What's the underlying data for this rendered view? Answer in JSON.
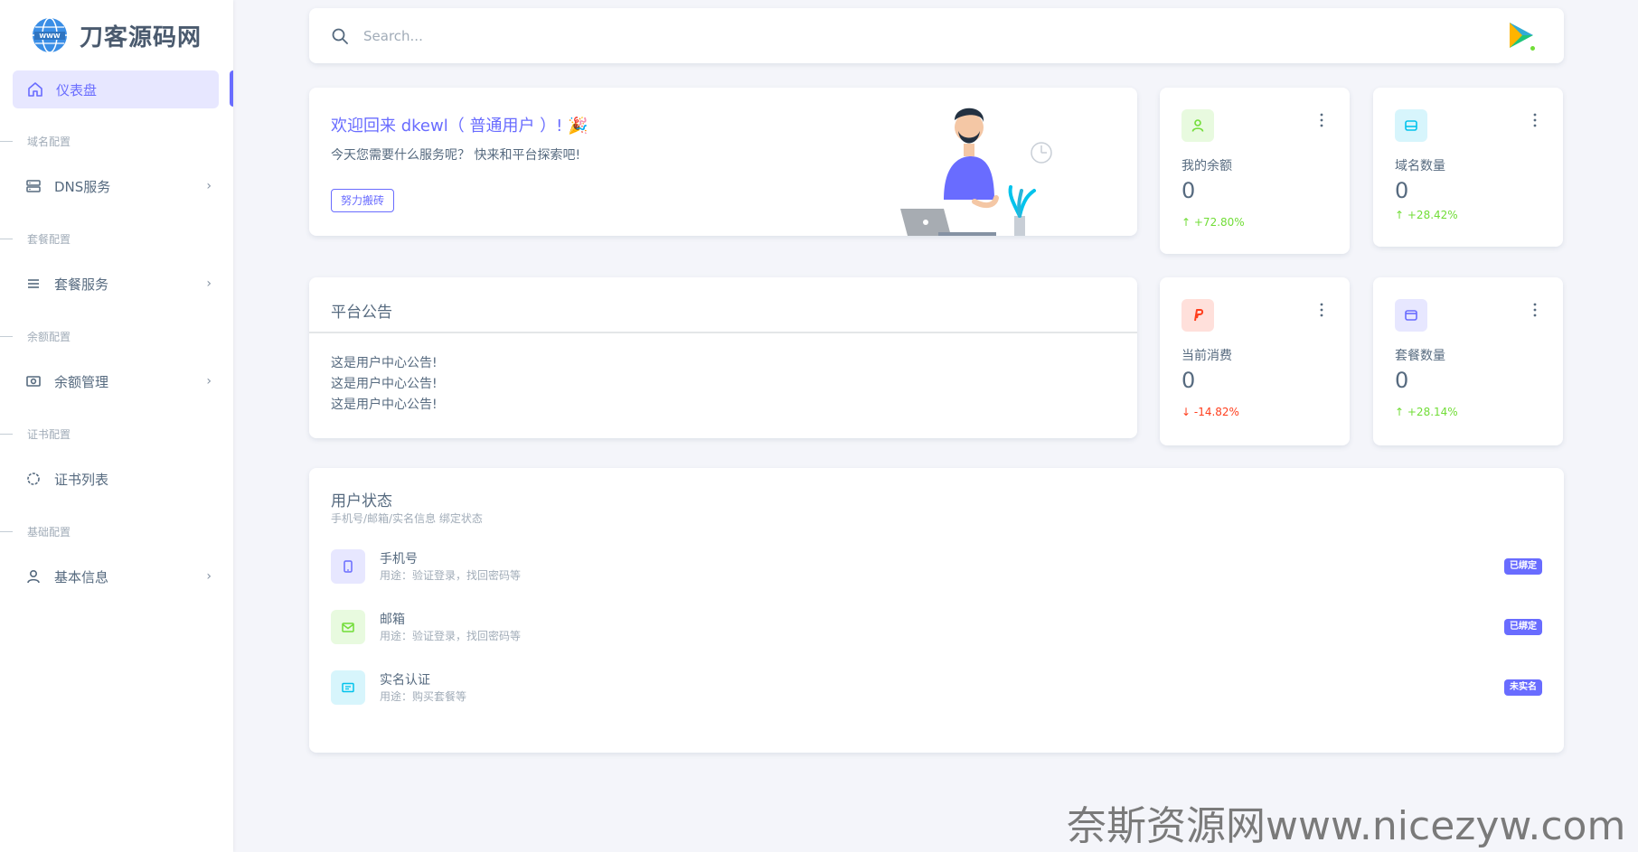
{
  "brand": {
    "name": "刀客源码网"
  },
  "sidebar": {
    "active": {
      "label": "仪表盘"
    },
    "sections": [
      {
        "head": "域名配置",
        "item": "DNS服务"
      },
      {
        "head": "套餐配置",
        "item": "套餐服务"
      },
      {
        "head": "余额配置",
        "item": "余额管理"
      },
      {
        "head": "证书配置",
        "item": "证书列表"
      },
      {
        "head": "基础配置",
        "item": "基本信息"
      }
    ]
  },
  "search": {
    "placeholder": "Search..."
  },
  "welcome": {
    "title": "欢迎回来 dkewl（ 普通用户 ）! 🎉",
    "subtitle": "今天您需要什么服务呢？ 快来和平台探索吧!",
    "button": "努力搬砖"
  },
  "notice": {
    "title": "平台公告",
    "lines": [
      "这是用户中心公告!",
      "这是用户中心公告!",
      "这是用户中心公告!"
    ]
  },
  "stats": [
    {
      "label": "我的余额",
      "value": "0",
      "change": "+72.80%",
      "direction": "up",
      "icon": "user-icon",
      "color": "#71dd37",
      "bg": "#e8fadf"
    },
    {
      "label": "域名数量",
      "value": "0",
      "change": "+28.42%",
      "direction": "up",
      "icon": "drive-icon",
      "color": "#03c3ec",
      "bg": "#d7f5fc"
    },
    {
      "label": "当前消费",
      "value": "0",
      "change": "-14.82%",
      "direction": "down",
      "icon": "paypal-icon",
      "color": "#ff3e1d",
      "bg": "#ffe0db"
    },
    {
      "label": "套餐数量",
      "value": "0",
      "change": "+28.14%",
      "direction": "up",
      "icon": "wallet-icon",
      "color": "#696cff",
      "bg": "#e7e7ff"
    }
  ],
  "user_status": {
    "title": "用户状态",
    "subtitle": "手机号/邮箱/实名信息 绑定状态",
    "rows": [
      {
        "name": "手机号",
        "desc": "用途：验证登录，找回密码等",
        "badge": "已绑定",
        "icon": "phone-icon",
        "color": "#696cff",
        "bg": "#e7e7ff"
      },
      {
        "name": "邮箱",
        "desc": "用途：验证登录，找回密码等",
        "badge": "已绑定",
        "icon": "mail-icon",
        "color": "#71dd37",
        "bg": "#e8fadf"
      },
      {
        "name": "实名认证",
        "desc": "用途：购买套餐等",
        "badge": "未实名",
        "icon": "id-card-icon",
        "color": "#03c3ec",
        "bg": "#d7f5fc"
      }
    ]
  },
  "watermark": "奈斯资源网www.nicezyw.com",
  "colors": {
    "primary": "#696cff",
    "success": "#71dd37",
    "danger": "#ff3e1d",
    "info": "#03c3ec"
  }
}
